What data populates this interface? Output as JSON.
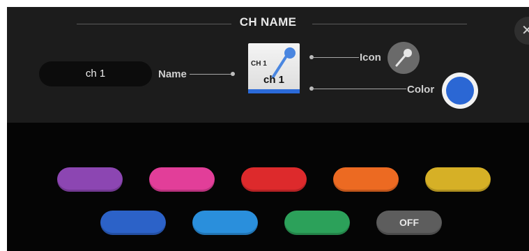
{
  "dialog": {
    "title": "CH NAME",
    "close_symbol": "✕"
  },
  "name_section": {
    "field_value": "ch 1",
    "label": "Name"
  },
  "channel_icon_preview": {
    "small_label": "CH 1",
    "name_label": "ch 1",
    "icon": "microphone-icon",
    "color": "#2b6ad8"
  },
  "icon_section": {
    "label": "Icon",
    "icon": "microphone-icon"
  },
  "color_section": {
    "label": "Color",
    "selected_color": "#2b67d4"
  },
  "palette": [
    {
      "name": "purple",
      "color": "#8c46b2"
    },
    {
      "name": "magenta",
      "color": "#e23e99"
    },
    {
      "name": "red",
      "color": "#dd2a2c"
    },
    {
      "name": "orange",
      "color": "#ec6a22"
    },
    {
      "name": "yellow",
      "color": "#d6b026"
    },
    {
      "name": "blue",
      "color": "#2c62c8"
    },
    {
      "name": "sky-blue",
      "color": "#2a8fdc"
    },
    {
      "name": "green",
      "color": "#2ca15a"
    },
    {
      "name": "off",
      "color": "#5d5d5d",
      "label": "OFF"
    }
  ]
}
